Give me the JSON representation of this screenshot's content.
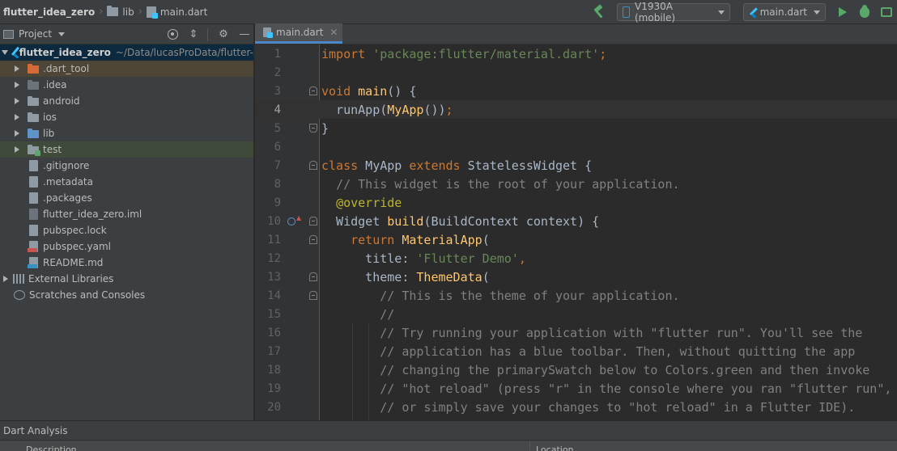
{
  "breadcrumb": {
    "project": "flutter_idea_zero",
    "folder": "lib",
    "file": "main.dart"
  },
  "toolbar": {
    "device": "V1930A (mobile)",
    "run_config": "main.dart"
  },
  "project_panel": {
    "title": "Project",
    "root": {
      "name": "flutter_idea_zero",
      "path": "~/Data/lucasProData/flutter-"
    },
    "items": [
      {
        "label": ".dart_tool"
      },
      {
        "label": ".idea"
      },
      {
        "label": "android"
      },
      {
        "label": "ios"
      },
      {
        "label": "lib"
      },
      {
        "label": "test"
      },
      {
        "label": ".gitignore"
      },
      {
        "label": ".metadata"
      },
      {
        "label": ".packages"
      },
      {
        "label": "flutter_idea_zero.iml"
      },
      {
        "label": "pubspec.lock"
      },
      {
        "label": "pubspec.yaml"
      },
      {
        "label": "README.md"
      },
      {
        "label": "External Libraries"
      },
      {
        "label": "Scratches and Consoles"
      }
    ]
  },
  "editor": {
    "tab": "main.dart",
    "current_line": 4,
    "line_numbers": [
      "1",
      "2",
      "3",
      "4",
      "5",
      "6",
      "7",
      "8",
      "9",
      "10",
      "11",
      "12",
      "13",
      "14",
      "15",
      "16",
      "17",
      "18",
      "19",
      "20"
    ]
  },
  "bottom_panel": {
    "title": "Dart Analysis",
    "columns": [
      "Description",
      "Location"
    ]
  }
}
